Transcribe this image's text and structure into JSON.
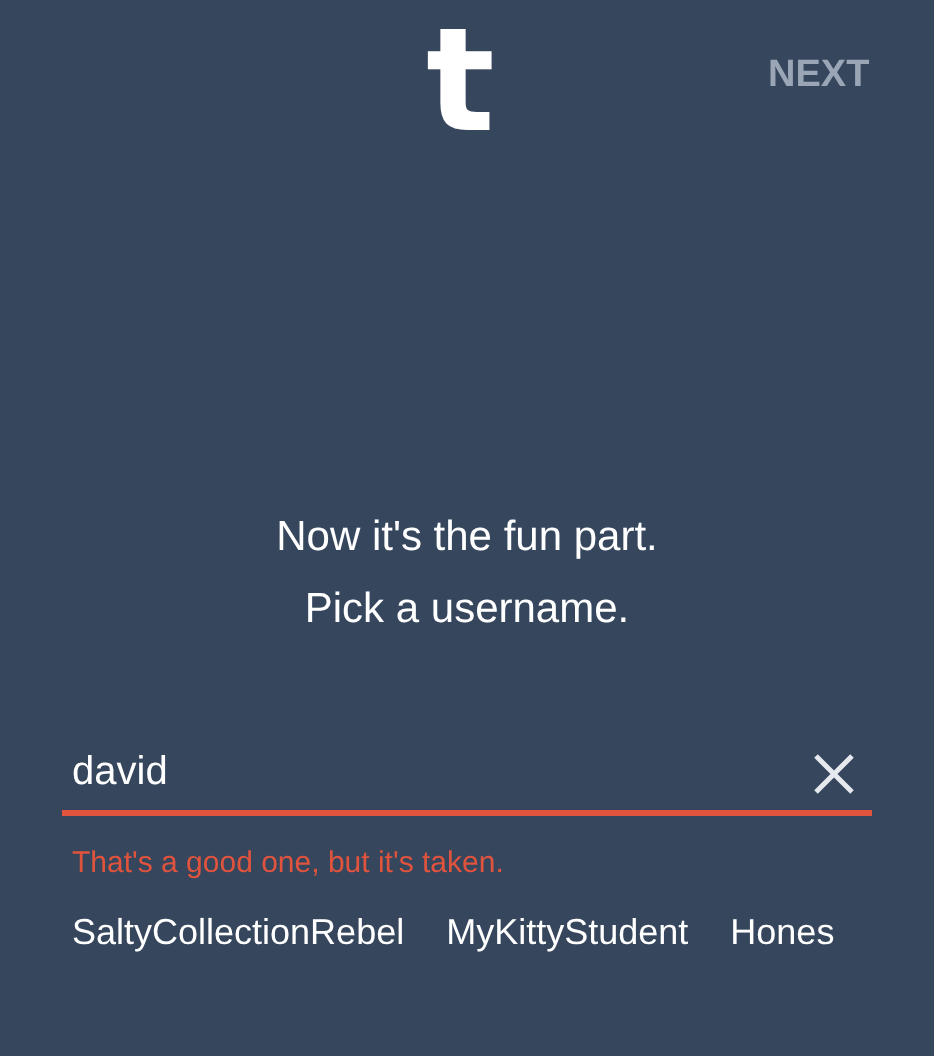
{
  "logo": {
    "text": "t"
  },
  "next_button": {
    "label": "NEXT"
  },
  "prompt": [
    "Now it's the fun part.",
    "Pick a username."
  ],
  "username_field": {
    "value": "david",
    "error": true
  },
  "error_message": "That's a good one, but it's taken.",
  "suggestions": [
    "SaltyCollectionRebel",
    "MyKittyStudent",
    "Hones"
  ]
}
